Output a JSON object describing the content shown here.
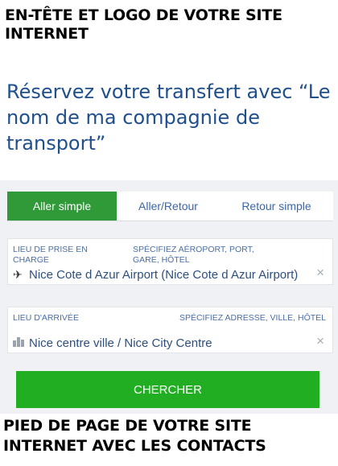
{
  "header": {
    "text": "EN-TÊTE ET LOGO DE VOTRE SITE INTERNET"
  },
  "headline": {
    "text": "Réservez votre transfert avec “Le nom de ma compagnie de transport”"
  },
  "tabs": [
    {
      "label": "Aller simple",
      "active": true
    },
    {
      "label": "Aller/Retour",
      "active": false
    },
    {
      "label": "Retour simple",
      "active": false
    }
  ],
  "pickup": {
    "label": "LIEU DE PRISE EN CHARGE",
    "hint": "SPÉCIFIEZ AÉROPORT, PORT, GARE, HÔTEL",
    "value": "Nice Cote d Azur Airport (Nice Cote d Azur Airport)",
    "icon": "airplane-icon",
    "clear": "×"
  },
  "dropoff": {
    "label": "LIEU D'ARRIVÉE",
    "hint": "SPÉCIFIEZ ADRESSE, VILLE, HÔTEL",
    "value": "Nice centre ville / Nice City Centre",
    "icon": "building-icon",
    "clear": "×"
  },
  "search_button": {
    "label": "CHERCHER"
  },
  "footer": {
    "text": "PIED DE PAGE DE VOTRE SITE INTERNET AVEC LES CONTACTS"
  },
  "colors": {
    "active_tab": "#2f9a37",
    "button": "#21ae22",
    "link": "#3a66a8",
    "headline": "#1f4f8c"
  }
}
